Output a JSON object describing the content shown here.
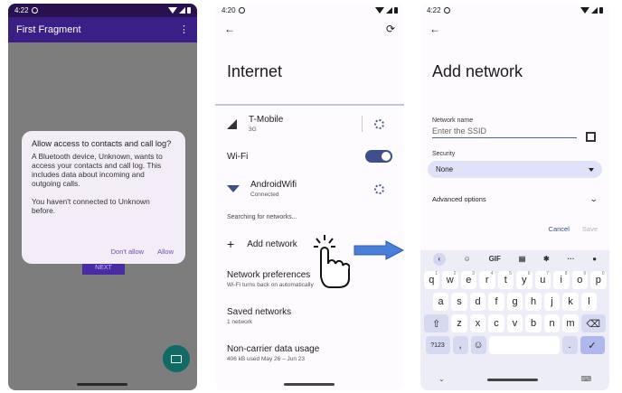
{
  "phone1": {
    "status_time": "4:22",
    "app_title": "First Fragment",
    "dialog": {
      "title": "Allow access to contacts and call log?",
      "body": "A Bluetooth device, Unknown, wants to access your contacts and call log. This includes data about incoming and outgoing calls.",
      "body2": "You haven't connected to Unknown before.",
      "deny_label": "Don't allow",
      "allow_label": "Allow"
    },
    "next_label": "NEXT",
    "colors": {
      "appbar": "#3a1f87",
      "fab": "#0f6b63"
    }
  },
  "phone2": {
    "status_time": "4:20",
    "title": "Internet",
    "carrier": {
      "name": "T-Mobile",
      "sub": "3G"
    },
    "wifi_label": "Wi-Fi",
    "network": {
      "name": "AndroidWifi",
      "sub": "Connected"
    },
    "searching": "Searching for networks...",
    "add_network": "Add network",
    "prefs": {
      "title": "Network preferences",
      "sub": "Wi-Fi turns back on automatically"
    },
    "saved": {
      "title": "Saved networks",
      "sub": "1 network"
    },
    "usage": {
      "title": "Non-carrier data usage",
      "sub": "406 kB used May 26 – Jun 23"
    }
  },
  "phone3": {
    "status_time": "4:22",
    "title": "Add network",
    "name_label": "Network name",
    "ssid_placeholder": "Enter the SSID",
    "security_label": "Security",
    "security_value": "None",
    "advanced": "Advanced options",
    "cancel": "Cancel",
    "save": "Save",
    "keyboard": {
      "gif": "GIF",
      "row1": [
        "q",
        "w",
        "e",
        "r",
        "t",
        "y",
        "u",
        "i",
        "o",
        "p"
      ],
      "row1_nums": [
        "1",
        "2",
        "3",
        "4",
        "5",
        "6",
        "7",
        "8",
        "9",
        "0"
      ],
      "row2": [
        "a",
        "s",
        "d",
        "f",
        "g",
        "h",
        "j",
        "k",
        "l"
      ],
      "row3": [
        "z",
        "x",
        "c",
        "v",
        "b",
        "n",
        "m"
      ],
      "sym": "?123",
      "comma": ",",
      "period": "."
    }
  }
}
